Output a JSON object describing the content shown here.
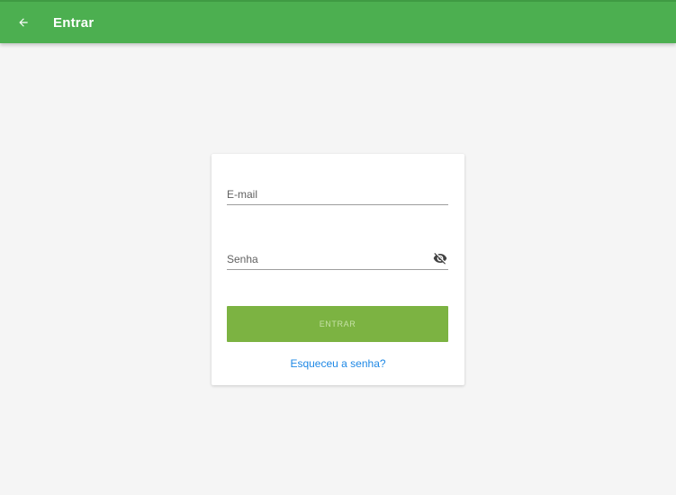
{
  "appbar": {
    "back_icon": "arrow-left-icon",
    "title": "Entrar",
    "color": "#4caf50"
  },
  "login_form": {
    "email": {
      "value": "",
      "placeholder": "E-mail"
    },
    "password": {
      "value": "",
      "placeholder": "Senha",
      "visibility_icon": "eye-off-icon"
    },
    "submit_label": "ENTRAR",
    "submit_color": "#7cb342",
    "forgot_password_label": "Esqueceu a senha?",
    "link_color": "#1e88e5"
  }
}
